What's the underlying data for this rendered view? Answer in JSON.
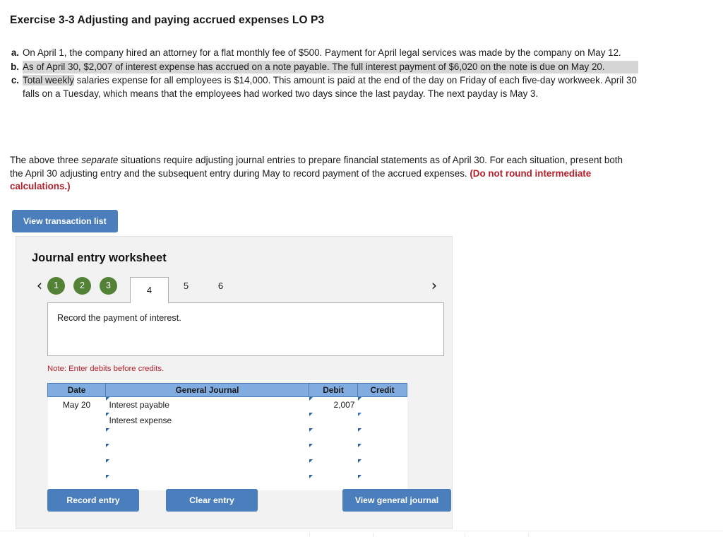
{
  "exercise": {
    "title": "Exercise 3-3 Adjusting and paying accrued expenses LO P3",
    "items": [
      {
        "letter": "a.",
        "text": "On April 1, the company hired an attorney for a flat monthly fee of $500. Payment for April legal services was made by the company on May 12.",
        "highlighted": false
      },
      {
        "letter": "b.",
        "text": "As of April 30, $2,007 of interest expense has accrued on a note payable. The full interest payment of $6,020 on the note is due on May 20.",
        "highlighted": true
      },
      {
        "letter": "c.",
        "text_highlighted": "Total weekly",
        "text": " salaries expense for all employees is $14,000. This amount is paid at the end of the day on Friday of each five-day workweek. April 30 falls on a Tuesday, which means that the employees had worked two days since the last payday. The next payday is May 3.",
        "highlighted": false
      }
    ],
    "paragraph_part1": "The above three ",
    "paragraph_emphasis": "separate",
    "paragraph_part2": " situations require adjusting journal entries to prepare financial statements as of April 30. For each situation, present both the April 30 adjusting entry and the subsequent entry during May to record payment of the accrued expenses. ",
    "paragraph_red": "(Do not round intermediate calculations.)"
  },
  "view_transaction_list_button": "View transaction list",
  "worksheet": {
    "title": "Journal entry worksheet",
    "prev_icon": "‹",
    "next_icon": "›",
    "tabs": [
      {
        "label": "1",
        "state": "done"
      },
      {
        "label": "2",
        "state": "done"
      },
      {
        "label": "3",
        "state": "done"
      },
      {
        "label": "4",
        "state": "active"
      },
      {
        "label": "5",
        "state": "plain"
      },
      {
        "label": "6",
        "state": "plain"
      }
    ],
    "prompt": "Record the payment of interest.",
    "note": "Note: Enter debits before credits.",
    "table": {
      "headers": [
        "Date",
        "General Journal",
        "Debit",
        "Credit"
      ],
      "rows": [
        {
          "date": "May 20",
          "account": "Interest payable",
          "debit": "2,007",
          "credit": "",
          "credit_focused": false
        },
        {
          "date": "",
          "account": "Interest expense",
          "debit": "",
          "credit": "",
          "credit_focused": true
        },
        {
          "date": "",
          "account": "",
          "debit": "",
          "credit": "",
          "credit_focused": false
        },
        {
          "date": "",
          "account": "",
          "debit": "",
          "credit": "",
          "credit_focused": false
        },
        {
          "date": "",
          "account": "",
          "debit": "",
          "credit": "",
          "credit_focused": false
        },
        {
          "date": "",
          "account": "",
          "debit": "",
          "credit": "",
          "credit_focused": false
        }
      ]
    },
    "buttons": {
      "record_entry": "Record entry",
      "clear_entry": "Clear entry",
      "view_general_journal": "View general journal"
    }
  },
  "colors": {
    "primary_blue": "#4a7ebc",
    "table_header_blue": "#80ace0",
    "tab_done_green": "#538135",
    "alert_red": "#b5202b",
    "selection_gray": "#d6d6d6",
    "panel_gray": "#f2f2f2"
  }
}
